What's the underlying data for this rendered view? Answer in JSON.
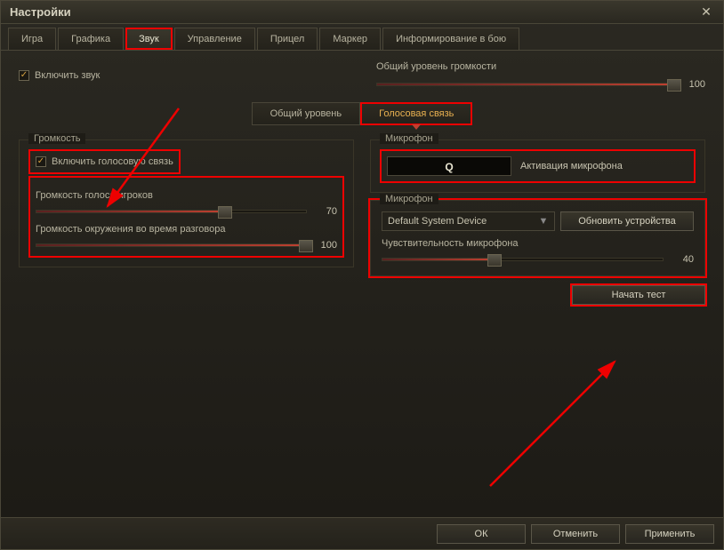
{
  "window": {
    "title": "Настройки"
  },
  "tabs": [
    "Игра",
    "Графика",
    "Звук",
    "Управление",
    "Прицел",
    "Маркер",
    "Информирование в бою"
  ],
  "active_tab_index": 2,
  "enable_sound": {
    "label": "Включить звук",
    "checked": true
  },
  "master_volume": {
    "label": "Общий уровень громкости",
    "value": 100
  },
  "subtabs": [
    "Общий уровень",
    "Голосовая связь"
  ],
  "active_subtab_index": 1,
  "volume_section": {
    "legend": "Громкость",
    "enable_voice": {
      "label": "Включить голосовую связь",
      "checked": true
    },
    "sliders": [
      {
        "label": "Громкость голоса игроков",
        "value": 70
      },
      {
        "label": "Громкость окружения во время разговора",
        "value": 100
      }
    ]
  },
  "mic_section": {
    "legend": "Микрофон",
    "ptt_key": "Q",
    "ptt_label": "Активация микрофона",
    "device_legend": "Микрофон",
    "device_selected": "Default System Device",
    "refresh_btn": "Обновить устройства",
    "sensitivity": {
      "label": "Чувствительность микрофона",
      "value": 40
    },
    "test_btn": "Начать тест"
  },
  "footer": {
    "ok": "ОК",
    "cancel": "Отменить",
    "apply": "Применить"
  }
}
